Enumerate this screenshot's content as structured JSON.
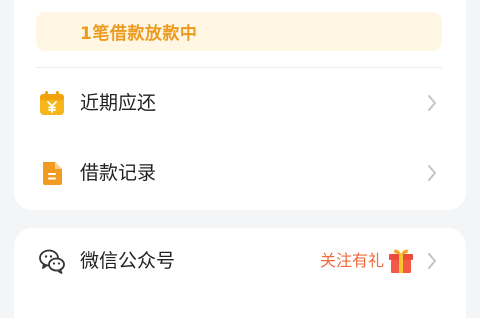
{
  "loan_status": {
    "banner_text": "1笔借款放款中"
  },
  "menu_items": [
    {
      "label": "近期应还",
      "icon": "calendar-yen-icon"
    },
    {
      "label": "借款记录",
      "icon": "document-icon"
    }
  ],
  "wechat": {
    "label": "微信公众号",
    "promo": "关注有礼",
    "icon": "wechat-icon",
    "promo_icon": "gift-icon"
  },
  "colors": {
    "accent_orange": "#ec9b1f",
    "banner_bg": "#fff7e4",
    "promo_red": "#ef6b3d",
    "icon_yellow": "#f6b51b",
    "icon_orange": "#f39a22"
  }
}
